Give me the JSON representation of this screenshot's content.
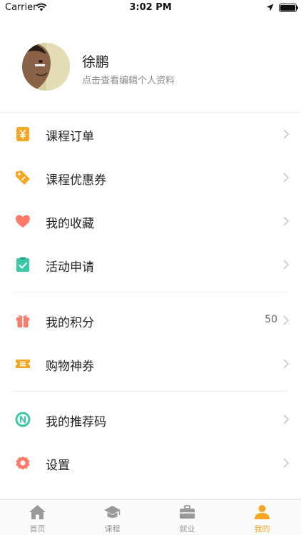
{
  "status_bar": {
    "carrier": "Carrier",
    "time": "3:02 PM"
  },
  "profile": {
    "name": "徐鹏",
    "subtitle": "点击查看编辑个人资料"
  },
  "menu": [
    {
      "label": "课程订单",
      "icon": "yen-icon",
      "value": ""
    },
    {
      "label": "课程优惠券",
      "icon": "tag-icon",
      "value": ""
    },
    {
      "label": "我的收藏",
      "icon": "heart-icon",
      "value": ""
    },
    {
      "label": "活动申请",
      "icon": "clipboard-check-icon",
      "value": ""
    },
    {
      "label": "我的积分",
      "icon": "gift-icon",
      "value": "50"
    },
    {
      "label": "购物神券",
      "icon": "ticket-icon",
      "value": ""
    },
    {
      "label": "我的推荐码",
      "icon": "n-badge-icon",
      "value": ""
    },
    {
      "label": "设置",
      "icon": "gear-icon",
      "value": ""
    }
  ],
  "tabs": [
    {
      "label": "首页",
      "icon": "home-icon",
      "active": false
    },
    {
      "label": "课程",
      "icon": "graduation-cap-icon",
      "active": false
    },
    {
      "label": "就业",
      "icon": "briefcase-icon",
      "active": false
    },
    {
      "label": "我的",
      "icon": "person-icon",
      "active": true
    }
  ],
  "colors": {
    "accent": "#f5a623",
    "heart": "#ff7a6b",
    "check": "#3cc9a8",
    "badge": "#3cc9a8",
    "gear": "#ff7a6b"
  }
}
